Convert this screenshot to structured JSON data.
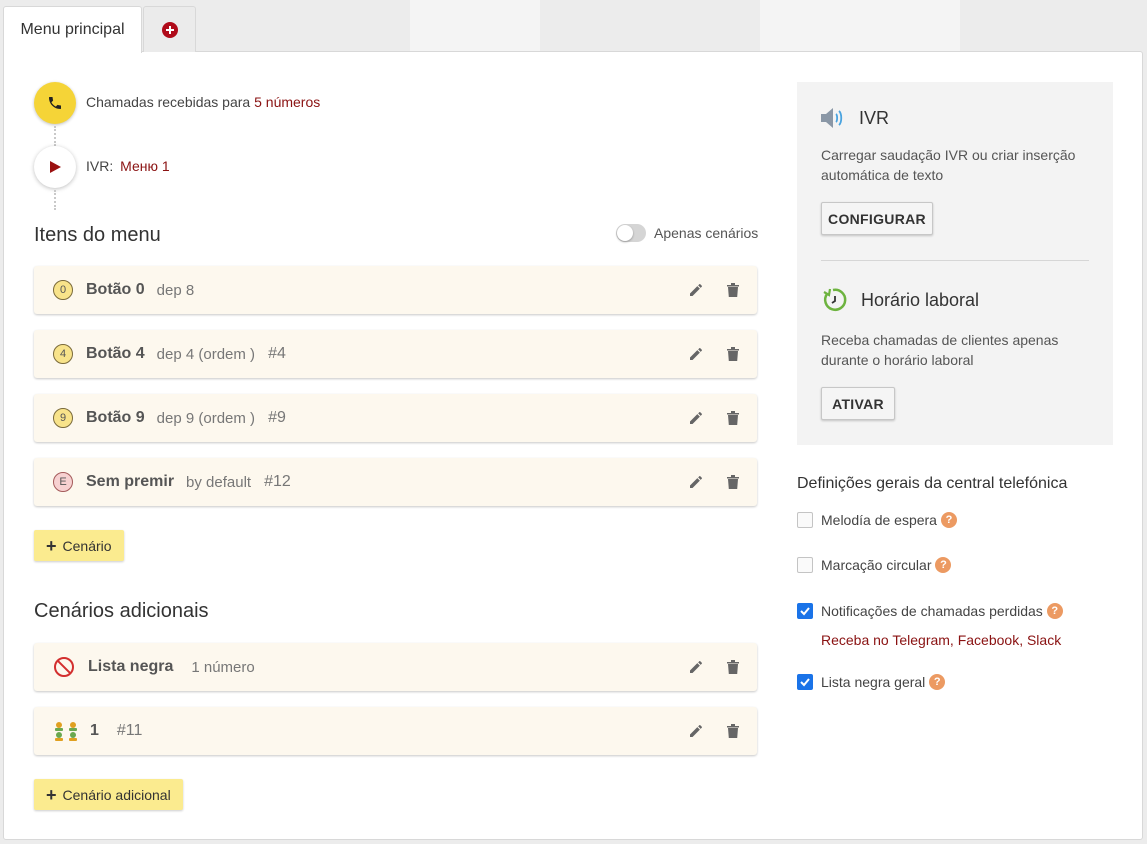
{
  "tabs": {
    "main_label": "Menu principal",
    "add_icon": "plus-circle-icon"
  },
  "flow": {
    "calls_text": "Chamadas recebidas para",
    "calls_link": "5 números",
    "ivr_label": "IVR:",
    "ivr_link": "Меню 1"
  },
  "menu": {
    "title": "Itens do menu",
    "toggle_label": "Apenas cenários",
    "items": [
      {
        "badge": "0",
        "name": "Botão 0",
        "sub": "dep 8",
        "hash": ""
      },
      {
        "badge": "4",
        "name": "Botão 4",
        "sub": "dep 4 (ordem )",
        "hash": "#4"
      },
      {
        "badge": "9",
        "name": "Botão 9",
        "sub": "dep 9 (ordem )",
        "hash": "#9"
      },
      {
        "badge": "E",
        "name": "Sem premir",
        "sub": "by default",
        "hash": "#12"
      }
    ],
    "add_label": "Cenário"
  },
  "additional": {
    "title": "Cenários adicionais",
    "items": [
      {
        "icon": "blocked-icon",
        "name": "Lista negra",
        "sub": "1 número"
      },
      {
        "icon": "users-icon",
        "name": "1",
        "hash": "#11"
      }
    ],
    "add_label": "Cenário adicional"
  },
  "ivr_card": {
    "title": "IVR",
    "desc": "Carregar saudação IVR ou criar inserção automática de texto",
    "button": "CONFIGURAR"
  },
  "hours_card": {
    "title": "Horário laboral",
    "desc": "Receba chamadas de clientes apenas durante o horário laboral",
    "button": "ATIVAR"
  },
  "settings": {
    "title": "Definições gerais da central telefónica",
    "options": [
      {
        "label": "Melodía de espera",
        "checked": false
      },
      {
        "label": "Marcação circular",
        "checked": false
      },
      {
        "label": "Notificações de chamadas perdidas",
        "checked": true
      },
      {
        "label": "Lista negra geral",
        "checked": true
      }
    ],
    "help_glyph": "?",
    "notifications_link": "Receba no Telegram, Facebook, Slack"
  },
  "colors": {
    "accent_yellow": "#f5d437",
    "brand_red": "#8a1212",
    "check_blue": "#1a73e8"
  }
}
